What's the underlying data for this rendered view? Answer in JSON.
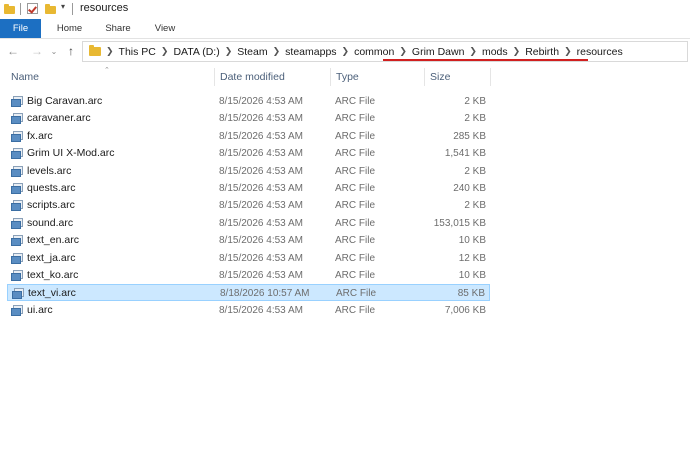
{
  "window": {
    "title": "resources"
  },
  "ribbon": {
    "tabs": [
      "File",
      "Home",
      "Share",
      "View"
    ]
  },
  "address": {
    "crumbs": [
      "This PC",
      "DATA (D:)",
      "Steam",
      "steamapps",
      "common",
      "Grim Dawn",
      "mods",
      "Rebirth",
      "resources"
    ]
  },
  "columns": {
    "name": "Name",
    "date": "Date modified",
    "type": "Type",
    "size": "Size"
  },
  "files": [
    {
      "name": "Big Caravan.arc",
      "date": "8/15/2026 4:53 AM",
      "type": "ARC File",
      "size": "2 KB"
    },
    {
      "name": "caravaner.arc",
      "date": "8/15/2026 4:53 AM",
      "type": "ARC File",
      "size": "2 KB"
    },
    {
      "name": "fx.arc",
      "date": "8/15/2026 4:53 AM",
      "type": "ARC File",
      "size": "285 KB"
    },
    {
      "name": "Grim UI X-Mod.arc",
      "date": "8/15/2026 4:53 AM",
      "type": "ARC File",
      "size": "1,541 KB"
    },
    {
      "name": "levels.arc",
      "date": "8/15/2026 4:53 AM",
      "type": "ARC File",
      "size": "2 KB"
    },
    {
      "name": "quests.arc",
      "date": "8/15/2026 4:53 AM",
      "type": "ARC File",
      "size": "240 KB"
    },
    {
      "name": "scripts.arc",
      "date": "8/15/2026 4:53 AM",
      "type": "ARC File",
      "size": "2 KB"
    },
    {
      "name": "sound.arc",
      "date": "8/15/2026 4:53 AM",
      "type": "ARC File",
      "size": "153,015 KB"
    },
    {
      "name": "text_en.arc",
      "date": "8/15/2026 4:53 AM",
      "type": "ARC File",
      "size": "10 KB"
    },
    {
      "name": "text_ja.arc",
      "date": "8/15/2026 4:53 AM",
      "type": "ARC File",
      "size": "12 KB"
    },
    {
      "name": "text_ko.arc",
      "date": "8/15/2026 4:53 AM",
      "type": "ARC File",
      "size": "10 KB"
    },
    {
      "name": "text_vi.arc",
      "date": "8/18/2026 10:57 AM",
      "type": "ARC File",
      "size": "85 KB",
      "selected": true
    },
    {
      "name": "ui.arc",
      "date": "8/15/2026 4:53 AM",
      "type": "ARC File",
      "size": "7,006 KB"
    }
  ],
  "colors": {
    "file_tab": "#1c6fc2",
    "selection": "#cce8ff",
    "annotation_underline": "#d11f1f"
  }
}
